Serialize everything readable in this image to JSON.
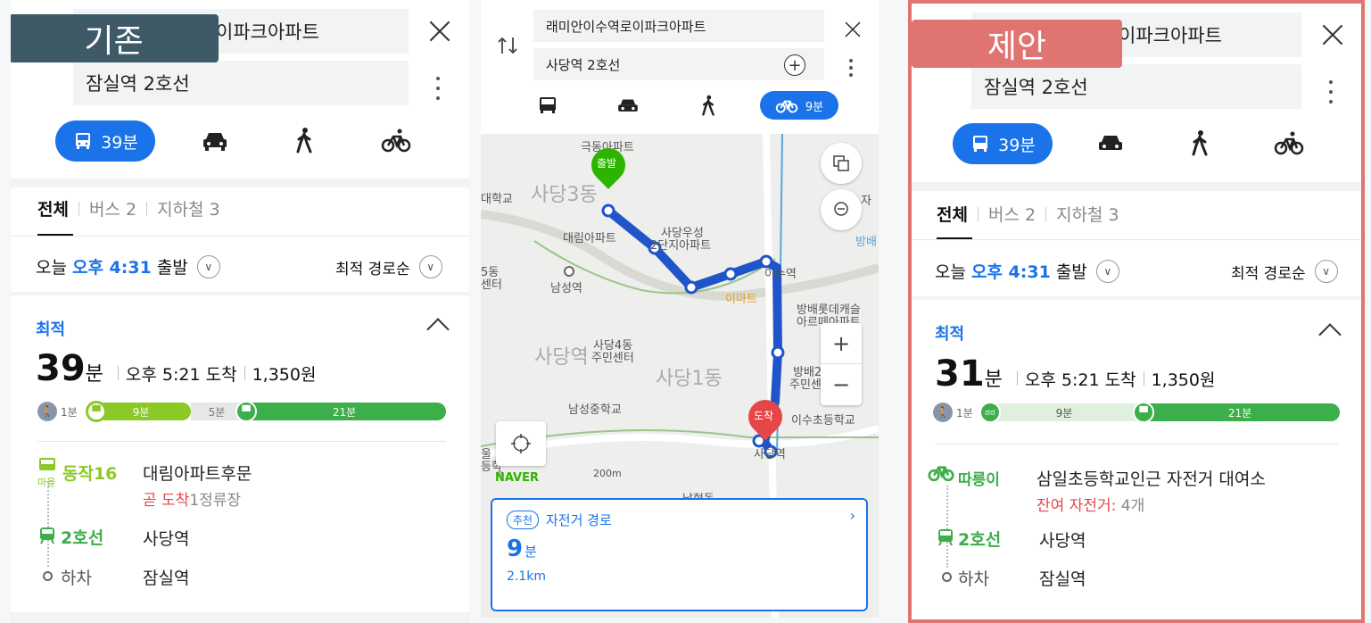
{
  "colors": {
    "accent": "#1a73e8",
    "green": "#3cae4a",
    "lime": "#8ac926",
    "red": "#e5464a",
    "tag_old": "#3d5a66",
    "tag_new": "#e07470"
  },
  "left": {
    "tag": "기존",
    "origin": "이파크아파트",
    "destination": "잠실역 2호선",
    "mode_time": "39분",
    "tabs": [
      "전체",
      "버스 2",
      "지하철 3"
    ],
    "depart": {
      "today": "오늘",
      "time": "오후 4:31",
      "suffix": "출발"
    },
    "sort": "최적 경로순",
    "best_label": "최적",
    "summary": {
      "minutes": "39",
      "unit": "분",
      "arrive": "오후 5:21 도착",
      "fare": "1,350원"
    },
    "bar": {
      "walk": "1분",
      "seg1": "9분",
      "seg2": "5분",
      "seg3": "21분"
    },
    "steps": [
      {
        "name": "동작16",
        "badge": "마을",
        "text": "대림아파트후문",
        "sub_red": "곧 도착",
        "sub": "1정류장"
      },
      {
        "name": "2호선",
        "text": "사당역"
      },
      {
        "name": "하차",
        "text": "잠실역"
      }
    ]
  },
  "middle": {
    "origin": "래미안이수역로이파크아파트",
    "destination": "사당역 2호선",
    "bike_time": "9분",
    "map_labels": {
      "l1": "극동아파트",
      "l2": "대학교",
      "l3": "사당3동",
      "l4": "대림아파트",
      "l5": "사당우성",
      "l6": "2단지아파트",
      "l7": "5동",
      "l8": "센터",
      "l9": "남성역",
      "l10": "이수역",
      "l11": "이마트",
      "l12": "방배롯데캐슬",
      "l13": "아르떼아파트",
      "l14": "방배",
      "l15": "사당4동",
      "l16": "주민센터",
      "l17": "사당역",
      "l18": "사당1동",
      "l19": "방배2",
      "l20": "주민센",
      "l21": "남성중학교",
      "l22": "이수초등학교",
      "l23": "사당역",
      "l24": "NAVER",
      "l25": "200m",
      "l26": "남현동",
      "l27": "자",
      "l28": "울",
      "l29": "등학"
    },
    "start_pin": "출발",
    "end_pin": "도착",
    "card": {
      "badge": "추천",
      "title": "자전거 경로",
      "minutes": "9",
      "unit": "분",
      "distance": "2.1km"
    }
  },
  "right": {
    "tag": "제안",
    "origin": "이파크아파트",
    "destination": "잠실역 2호선",
    "mode_time": "39분",
    "tabs": [
      "전체",
      "버스 2",
      "지하철 3"
    ],
    "depart": {
      "today": "오늘",
      "time": "오후 4:31",
      "suffix": "출발"
    },
    "sort": "최적 경로순",
    "best_label": "최적",
    "summary": {
      "minutes": "31",
      "unit": "분",
      "arrive": "오후 5:21 도착",
      "fare": "1,350원"
    },
    "bar": {
      "walk": "1분",
      "seg1": "9분",
      "seg2": "21분"
    },
    "steps": [
      {
        "name": "따릉이",
        "text": "삼일초등학교인근 자전거 대여소",
        "sub_red": "잔여 자전거:",
        "sub": " 4개"
      },
      {
        "name": "2호선",
        "text": "사당역"
      },
      {
        "name": "하차",
        "text": "잠실역"
      }
    ]
  }
}
